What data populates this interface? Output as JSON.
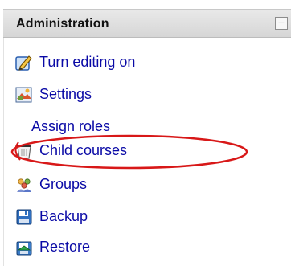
{
  "block": {
    "title": "Administration",
    "collapse_symbol": "−"
  },
  "items": [
    {
      "label": "Turn editing on",
      "icon": "edit-icon"
    },
    {
      "label": "Settings",
      "icon": "settings-icon"
    },
    {
      "label": "Assign roles",
      "icon": null
    },
    {
      "label": "Child courses",
      "icon": "child-courses-icon"
    },
    {
      "label": "Groups",
      "icon": "groups-icon"
    },
    {
      "label": "Backup",
      "icon": "backup-icon"
    },
    {
      "label": "Restore",
      "icon": "restore-icon"
    }
  ],
  "annotation": {
    "highlight_color": "#d81818",
    "highlighted_item": "Child courses"
  },
  "colors": {
    "link": "#0a0aa6",
    "header_bg": "#dcdcdc"
  }
}
